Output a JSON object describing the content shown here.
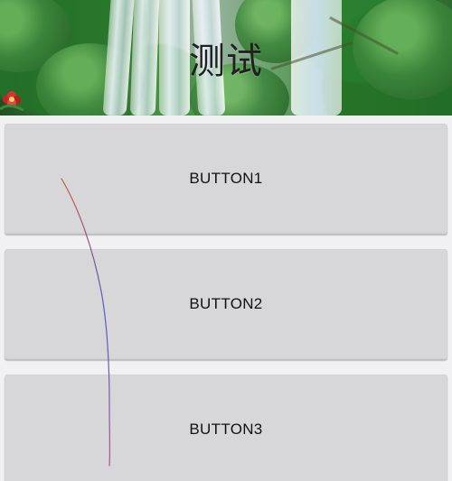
{
  "header": {
    "title": "测试",
    "background_image": "waterfall-forest",
    "decorative_icon": "flower-icon"
  },
  "buttons": [
    {
      "label": "BUTTON1"
    },
    {
      "label": "BUTTON2"
    },
    {
      "label": "BUTTON3"
    }
  ],
  "gesture": {
    "trail_icon": "touch-gesture-trail",
    "colors": [
      "#c85a3c",
      "#4d5ec8",
      "#a45a88"
    ]
  }
}
